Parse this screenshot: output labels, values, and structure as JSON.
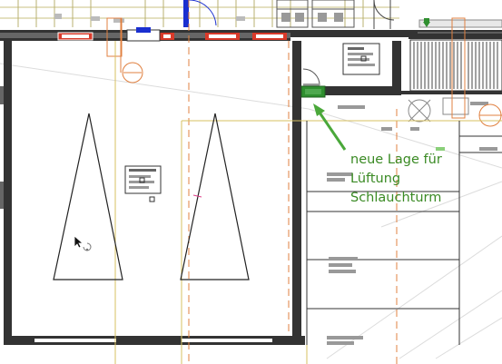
{
  "annotation": {
    "lines": [
      "neue Lage für",
      "Lüftung",
      "Schlauchturm"
    ]
  },
  "colors": {
    "wall": "#222222",
    "annotation": "#3a8a24",
    "marker_green": "#2f8f2f",
    "guide_orange": "#e08040",
    "guide_yellow": "#d7c060",
    "door_blue": "#1a2fd0",
    "window_red": "#d83a2a"
  },
  "icons": {
    "cursor": "arrow-pointer-with-rotate",
    "marker": "green-vent-rectangle"
  }
}
